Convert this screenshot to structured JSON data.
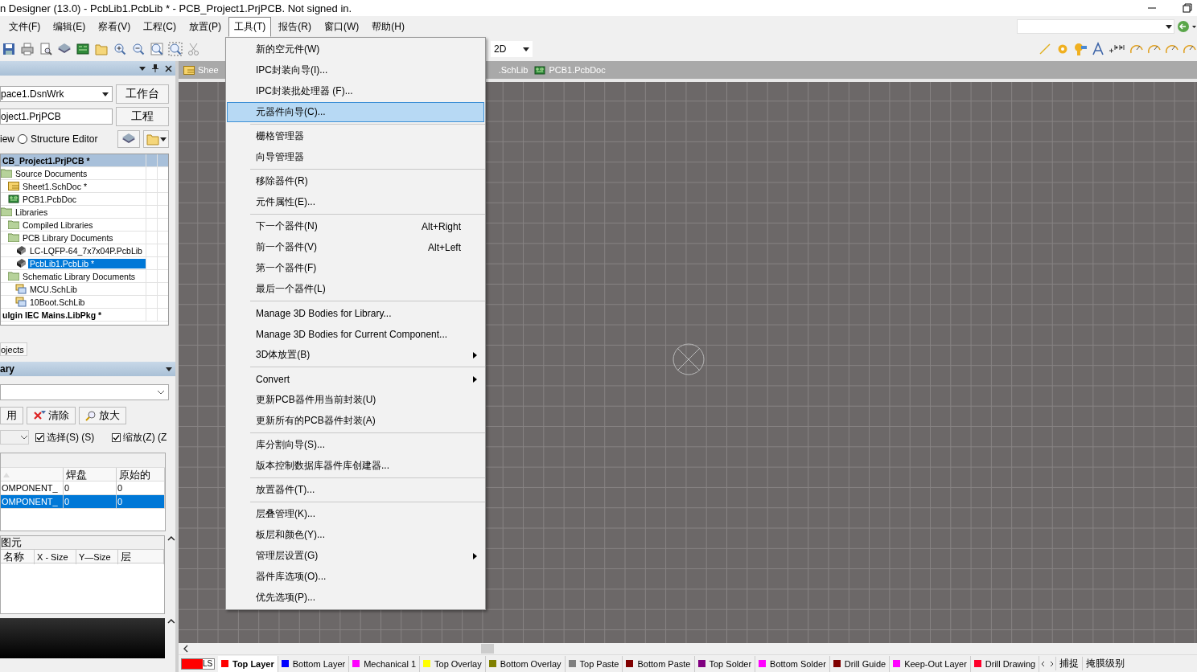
{
  "window": {
    "title": "n Designer (13.0) - PcbLib1.PcbLib * - PCB_Project1.PrjPCB. Not signed in."
  },
  "menu_bar": [
    {
      "label": "文件(F)",
      "selected": false
    },
    {
      "label": "编辑(E)",
      "selected": false
    },
    {
      "label": "察看(V)",
      "selected": false
    },
    {
      "label": "工程(C)",
      "selected": false
    },
    {
      "label": "放置(P)",
      "selected": false
    },
    {
      "label": "工具(T)",
      "selected": true
    },
    {
      "label": "报告(R)",
      "selected": false
    },
    {
      "label": "窗口(W)",
      "selected": false
    },
    {
      "label": "帮助(H)",
      "selected": false
    }
  ],
  "toolbar": {
    "view_mode": "2D"
  },
  "projects_panel": {
    "workspace": "pace1.DsnWrk",
    "workspace_button": "工作台",
    "project": "oject1.PrjPCB",
    "project_button": "工程",
    "view_option": "iew",
    "structure_editor": {
      "label": "Structure Editor",
      "selected": false
    },
    "tree": [
      {
        "label": "CB_Project1.PrjPCB *",
        "kind": "project",
        "active": true,
        "selected": false,
        "children": [
          {
            "label": "Source Documents",
            "kind": "folder",
            "selected": false,
            "children": [
              {
                "label": "Sheet1.SchDoc *",
                "kind": "schdoc",
                "selected": false
              },
              {
                "label": "PCB1.PcbDoc",
                "kind": "pcbdoc",
                "selected": false
              }
            ]
          },
          {
            "label": "Libraries",
            "kind": "folder",
            "selected": false,
            "children": [
              {
                "label": "Compiled Libraries",
                "kind": "folder",
                "selected": false
              },
              {
                "label": "PCB Library Documents",
                "kind": "folder",
                "selected": false,
                "children": [
                  {
                    "label": "LC-LQFP-64_7x7x04P.PcbLib",
                    "kind": "pcblib",
                    "selected": false
                  },
                  {
                    "label": "PcbLib1.PcbLib *",
                    "kind": "pcblib",
                    "selected": true
                  }
                ]
              },
              {
                "label": "Schematic Library Documents",
                "kind": "folder",
                "selected": false,
                "children": [
                  {
                    "label": "MCU.SchLib",
                    "kind": "schlib",
                    "selected": false
                  },
                  {
                    "label": "10Boot.SchLib",
                    "kind": "schlib",
                    "selected": false
                  }
                ]
              }
            ]
          }
        ]
      },
      {
        "label": "ulgin IEC Mains.LibPkg *",
        "kind": "project",
        "active": false,
        "selected": false
      }
    ],
    "tab": "ojects"
  },
  "library_panel": {
    "title": "ary",
    "buttons": [
      {
        "label": "用",
        "kind": "plain"
      },
      {
        "label": "清除",
        "kind": "clear"
      },
      {
        "label": "放大",
        "kind": "zoom"
      }
    ],
    "checks": [
      {
        "label": "选择(S) (S)",
        "checked": true
      },
      {
        "label": "缩放(Z) (Z",
        "checked": true
      }
    ],
    "components": {
      "columns": [
        "",
        "焊盘",
        "原始的"
      ],
      "rows": [
        {
          "cells": [
            "OMPONENT_",
            "0",
            "0"
          ],
          "selected": false
        },
        {
          "cells": [
            "OMPONENT_",
            "0",
            "0"
          ],
          "selected": true
        }
      ]
    },
    "primitives": {
      "title": "图元",
      "columns": [
        "名称",
        "X - Size",
        "Y—Size",
        "层"
      ]
    }
  },
  "doc_tabs": [
    {
      "label": "Shee",
      "kind": "schdoc"
    },
    {
      "label": ".SchLib"
    },
    {
      "label": "PCB1.PcbDoc",
      "kind": "pcbdoc"
    }
  ],
  "tools_menu": [
    [
      {
        "label": "新的空元件(W)",
        "selected": false
      },
      {
        "label": "IPC封装向导(I)...",
        "selected": false
      },
      {
        "label": "IPC封装批处理器 (F)...",
        "selected": false
      },
      {
        "label": "元器件向导(C)...",
        "selected": true
      }
    ],
    [
      {
        "label": "栅格管理器",
        "selected": false
      },
      {
        "label": "向导管理器",
        "selected": false
      }
    ],
    [
      {
        "label": "移除器件(R)",
        "selected": false
      },
      {
        "label": "元件属性(E)...",
        "selected": false
      }
    ],
    [
      {
        "label": "下一个器件(N)",
        "shortcut": "Alt+Right",
        "selected": false
      },
      {
        "label": "前一个器件(V)",
        "shortcut": "Alt+Left",
        "selected": false
      },
      {
        "label": "第一个器件(F)",
        "selected": false
      },
      {
        "label": "最后一个器件(L)",
        "selected": false
      }
    ],
    [
      {
        "label": "Manage 3D Bodies for Library...",
        "selected": false
      },
      {
        "label": "Manage 3D Bodies for Current Component...",
        "selected": false
      },
      {
        "label": "3D体放置(B)",
        "submenu": true,
        "selected": false
      }
    ],
    [
      {
        "label": "Convert",
        "submenu": true,
        "selected": false
      },
      {
        "label": "更新PCB器件用当前封装(U)",
        "selected": false
      },
      {
        "label": "更新所有的PCB器件封装(A)",
        "selected": false
      }
    ],
    [
      {
        "label": "库分割向导(S)...",
        "selected": false
      },
      {
        "label": "版本控制数据库器件库创建器...",
        "selected": false
      }
    ],
    [
      {
        "label": "放置器件(T)...",
        "selected": false
      }
    ],
    [
      {
        "label": "层叠管理(K)...",
        "selected": false
      },
      {
        "label": "板层和颜色(Y)...",
        "selected": false
      },
      {
        "label": "管理层设置(G)",
        "submenu": true,
        "selected": false
      },
      {
        "label": "器件库选项(O)...",
        "selected": false
      },
      {
        "label": "优先选项(P)...",
        "selected": false
      }
    ]
  ],
  "current_layer": {
    "label": "LS",
    "color": "#ff0000"
  },
  "layer_tabs": [
    {
      "label": "Top Layer",
      "color": "#ff0000",
      "selected": true
    },
    {
      "label": "Bottom Layer",
      "color": "#0000ff",
      "selected": false
    },
    {
      "label": "Mechanical 1",
      "color": "#ff00ff",
      "selected": false
    },
    {
      "label": "Top Overlay",
      "color": "#ffff00",
      "selected": false
    },
    {
      "label": "Bottom Overlay",
      "color": "#808000",
      "selected": false
    },
    {
      "label": "Top Paste",
      "color": "#808080",
      "selected": false
    },
    {
      "label": "Bottom Paste",
      "color": "#800000",
      "selected": false
    },
    {
      "label": "Top Solder",
      "color": "#800080",
      "selected": false
    },
    {
      "label": "Bottom Solder",
      "color": "#ff00ff",
      "selected": false
    },
    {
      "label": "Drill Guide",
      "color": "#800000",
      "selected": false
    },
    {
      "label": "Keep-Out Layer",
      "color": "#ff00ff",
      "selected": false
    },
    {
      "label": "Drill Drawing",
      "color": "#ff002a",
      "selected": false
    }
  ],
  "status": [
    "捕捉",
    "掩膜级别"
  ]
}
